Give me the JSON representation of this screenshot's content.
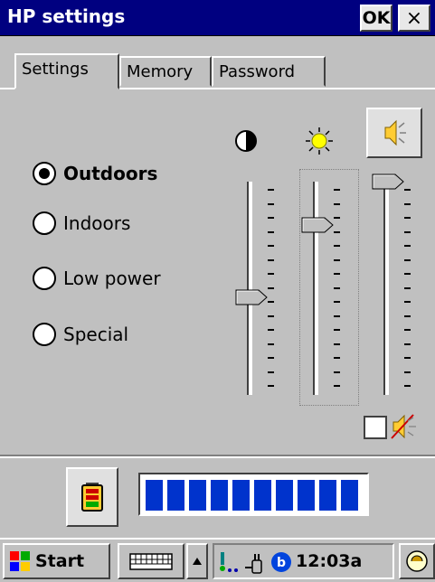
{
  "window": {
    "title": "HP settings",
    "ok_label": "OK",
    "close_label": "×"
  },
  "tabs": [
    {
      "label": "Settings",
      "active": true
    },
    {
      "label": "Memory",
      "active": false
    },
    {
      "label": "Password",
      "active": false
    }
  ],
  "profiles": [
    {
      "label": "Outdoors",
      "selected": true
    },
    {
      "label": "Indoors",
      "selected": false
    },
    {
      "label": "Low power",
      "selected": false
    },
    {
      "label": "Special",
      "selected": false
    }
  ],
  "sliders": [
    {
      "name": "contrast",
      "icon": "contrast-icon",
      "level_fraction": 0.42
    },
    {
      "name": "brightness",
      "icon": "sun-icon",
      "level_fraction": 0.78
    },
    {
      "name": "volume",
      "icon": "speaker-icon",
      "level_fraction": 1.0
    }
  ],
  "mute": {
    "checked": false,
    "icon": "speaker-muted-icon"
  },
  "battery": {
    "icon": "battery-icon",
    "segments_filled": 10,
    "segments_total": 10,
    "bar_color": "#0033cc"
  },
  "taskbar": {
    "start_label": "Start",
    "clock": "12:03a",
    "tray_icons": [
      "network-icon",
      "power-plug-icon",
      "bluetooth-icon"
    ]
  },
  "colors": {
    "titlebar": "#000080",
    "face": "#c0c0c0"
  }
}
